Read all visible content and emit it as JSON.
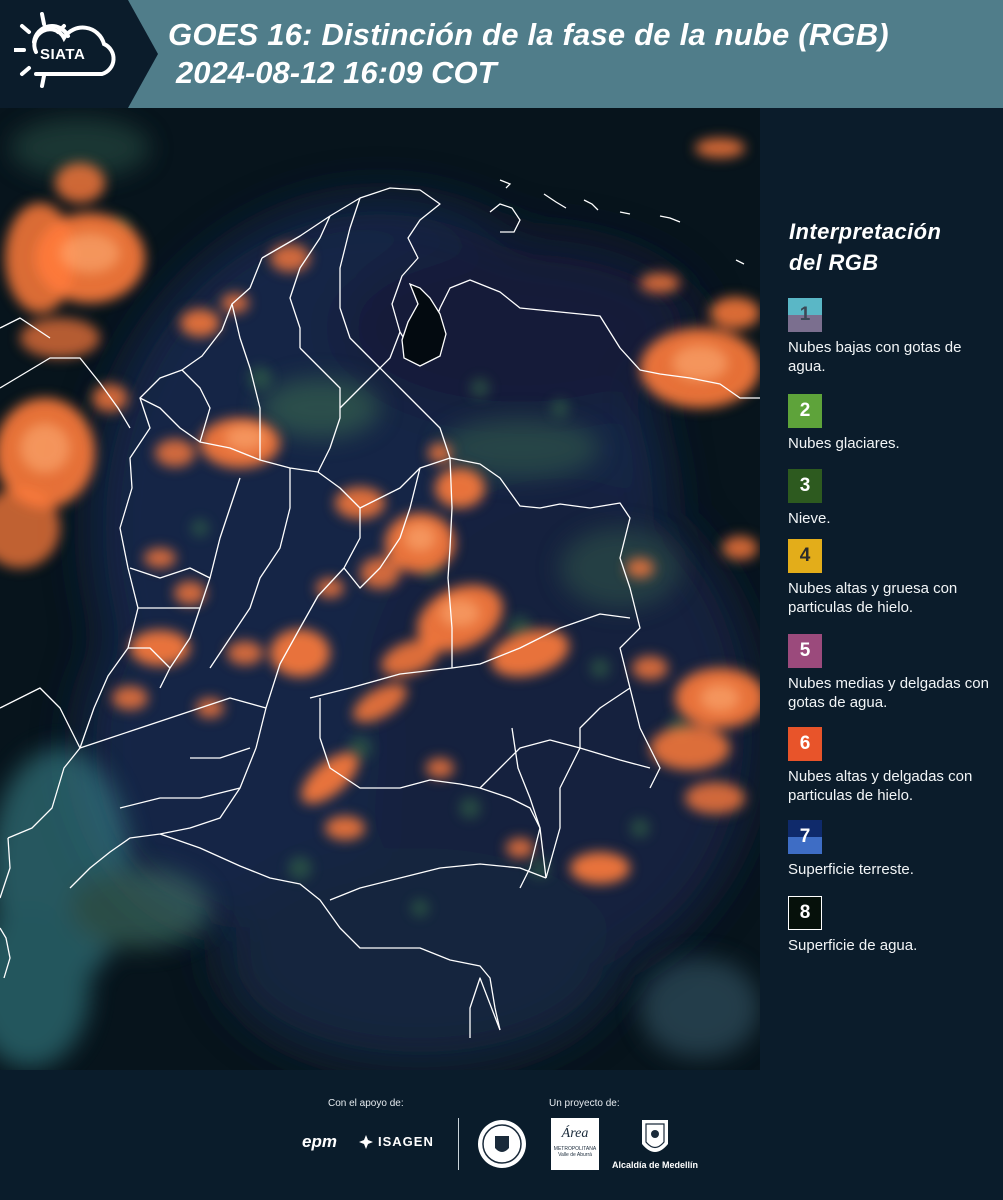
{
  "header": {
    "logo_text": "SIATA",
    "title": "GOES 16: Distinción de la fase de la nube (RGB)",
    "subtitle": "2024-08-12 16:09 COT"
  },
  "legend": {
    "title_line1": "Interpretación",
    "title_line2": "del RGB",
    "items": [
      {
        "num": "1",
        "label": "Nubes bajas con gotas de agua.",
        "color_top": "#5ab7c6",
        "color_bottom": "#7b6f8f",
        "num_color": "#3b4856"
      },
      {
        "num": "2",
        "label": "Nubes glaciares.",
        "color_top": "#5ea33a",
        "color_bottom": "#5ea33a",
        "num_color": "#ffffff"
      },
      {
        "num": "3",
        "label": "Nieve.",
        "color_top": "#2d5a1f",
        "color_bottom": "#2d5a1f",
        "num_color": "#ffffff"
      },
      {
        "num": "4",
        "label": "Nubes altas y gruesa con particulas de hielo.",
        "color_top": "#e3ad1a",
        "color_bottom": "#e3ad1a",
        "num_color": "#2b2b2b"
      },
      {
        "num": "5",
        "label": "Nubes medias y delgadas con gotas de agua.",
        "color_top": "#9b4a7c",
        "color_bottom": "#9b4a7c",
        "num_color": "#ffffff"
      },
      {
        "num": "6",
        "label": "Nubes altas y delgadas con particulas de hielo.",
        "color_top": "#e8542a",
        "color_bottom": "#e8542a",
        "num_color": "#ffffff"
      },
      {
        "num": "7",
        "label": "Superficie terreste.",
        "color_top": "#0f2a6b",
        "color_bottom": "#3e6dc5",
        "num_color": "#ffffff"
      },
      {
        "num": "8",
        "label": "Superficie de agua.",
        "color_top": "#06110b",
        "color_bottom": "#06110b",
        "num_color": "#ffffff"
      }
    ]
  },
  "footer": {
    "support_text": "Con el apoyo de:",
    "project_text": "Un proyecto de:",
    "sponsor_epm": "epm",
    "sponsor_isagen": "ISAGEN",
    "area_metro_name": "Área",
    "area_metro_sub1": "METROPOLITANA",
    "area_metro_sub2": "Valle de Aburrá",
    "alcaldia": "Alcaldía de Medellín"
  },
  "colors": {
    "header_bg": "#507d8a",
    "panel_bg": "#0b1c2b",
    "cloud_ice": "#ff7a3a",
    "borders": "#ffffff"
  }
}
